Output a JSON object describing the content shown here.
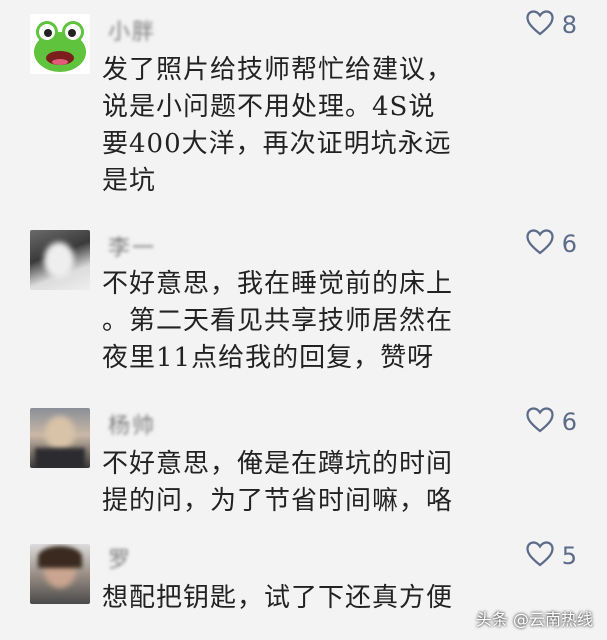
{
  "comments": [
    {
      "user_name": "小胖",
      "likes": "8",
      "content": "发了照片给技师帮忙给建议，\n说是小问题不用处理。4S说\n要400大洋，再次证明坑永远\n是坑",
      "avatar": "frog-avatar"
    },
    {
      "user_name": "李一",
      "likes": "6",
      "content": "不好意思，我在睡觉前的床上\n。第二天看见共享技师居然在\n夜里11点给我的回复，赞呀",
      "avatar": "photo-avatar"
    },
    {
      "user_name": "杨帅",
      "likes": "6",
      "content": "不好意思，俺是在蹲坑的时间\n提的问，为了节省时间嘛，咯",
      "avatar": "photo-avatar"
    },
    {
      "user_name": "罗",
      "likes": "5",
      "content": "想配把钥匙，试了下还真方便",
      "avatar": "photo-avatar"
    }
  ],
  "like_icon": "heart-outline-icon",
  "colors": {
    "like": "#5b6b89",
    "text": "#222222",
    "name": "#7c7c7c",
    "background": "#f3f3f3"
  },
  "watermark": "头条 @云南热线"
}
